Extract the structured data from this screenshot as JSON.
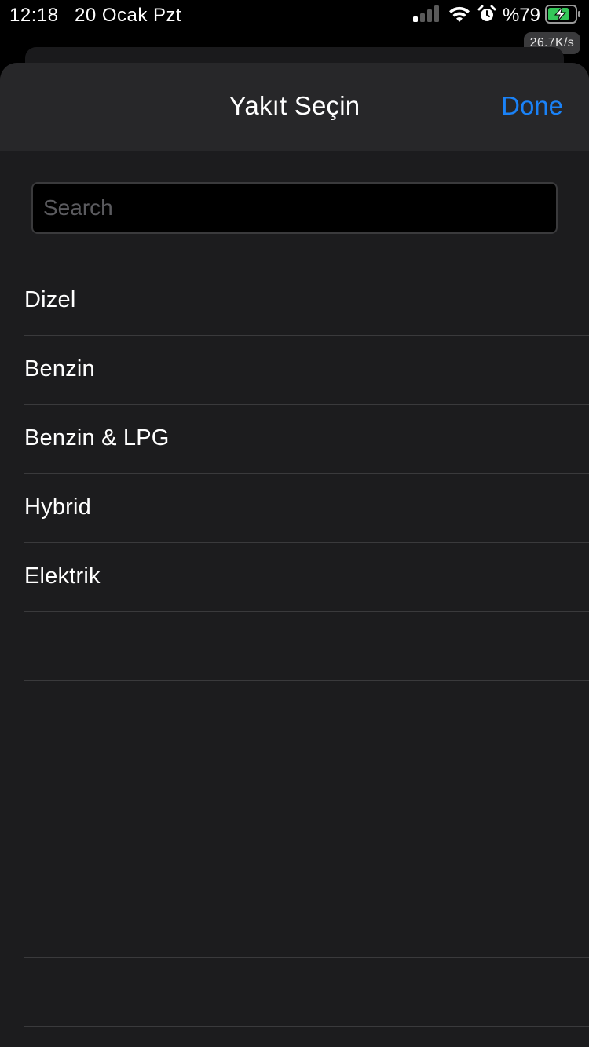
{
  "status_bar": {
    "time": "12:18",
    "date": "20 Ocak Pzt",
    "battery_percent": "%79",
    "battery_level": 0.79,
    "charging": true,
    "network_speed": "26.7K/s",
    "icons": [
      "signal-icon",
      "wifi-icon",
      "alarm-icon",
      "battery-icon"
    ]
  },
  "sheet": {
    "title": "Yakıt Seçin",
    "done_label": "Done",
    "search_placeholder": "Search",
    "search_value": ""
  },
  "fuel_options": [
    "Dizel",
    "Benzin",
    "Benzin & LPG",
    "Hybrid",
    "Elektrik"
  ],
  "empty_rows": 6,
  "colors": {
    "accent": "#1a82f7",
    "background": "#1c1c1e",
    "separator": "#3a3a3c",
    "battery_fill": "#34c759"
  }
}
